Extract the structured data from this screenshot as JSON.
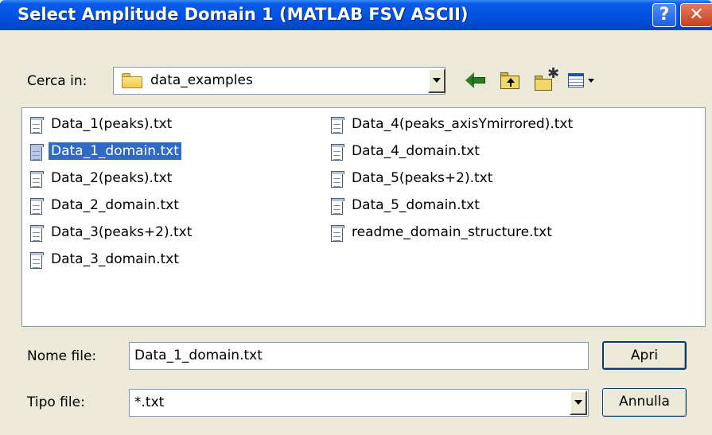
{
  "window": {
    "title": "Select Amplitude Domain 1 (MATLAB FSV ASCII)",
    "help_label": "?",
    "close_label": "✕"
  },
  "look_in": {
    "label": "Cerca in:",
    "value": "data_examples"
  },
  "toolbar": {
    "icons": [
      "back-arrow-icon",
      "up-one-level-icon",
      "new-folder-icon",
      "view-menu-icon"
    ]
  },
  "files": [
    {
      "name": "Data_1(peaks).txt",
      "selected": false
    },
    {
      "name": "Data_1_domain.txt",
      "selected": true
    },
    {
      "name": "Data_2(peaks).txt",
      "selected": false
    },
    {
      "name": "Data_2_domain.txt",
      "selected": false
    },
    {
      "name": "Data_3(peaks+2).txt",
      "selected": false
    },
    {
      "name": "Data_3_domain.txt",
      "selected": false
    },
    {
      "name": "Data_4(peaks_axisYmirrored).txt",
      "selected": false
    },
    {
      "name": "Data_4_domain.txt",
      "selected": false
    },
    {
      "name": "Data_5(peaks+2).txt",
      "selected": false
    },
    {
      "name": "Data_5_domain.txt",
      "selected": false
    },
    {
      "name": "readme_domain_structure.txt",
      "selected": false
    }
  ],
  "file_name": {
    "label": "Nome file:",
    "value": "Data_1_domain.txt"
  },
  "file_type": {
    "label": "Tipo file:",
    "value": "*.txt"
  },
  "buttons": {
    "open_label": "Apri",
    "cancel_label": "Annulla"
  },
  "colors": {
    "titlebar": "#0054e3",
    "selection": "#316ac5",
    "dialog_bg": "#ece9d8"
  }
}
